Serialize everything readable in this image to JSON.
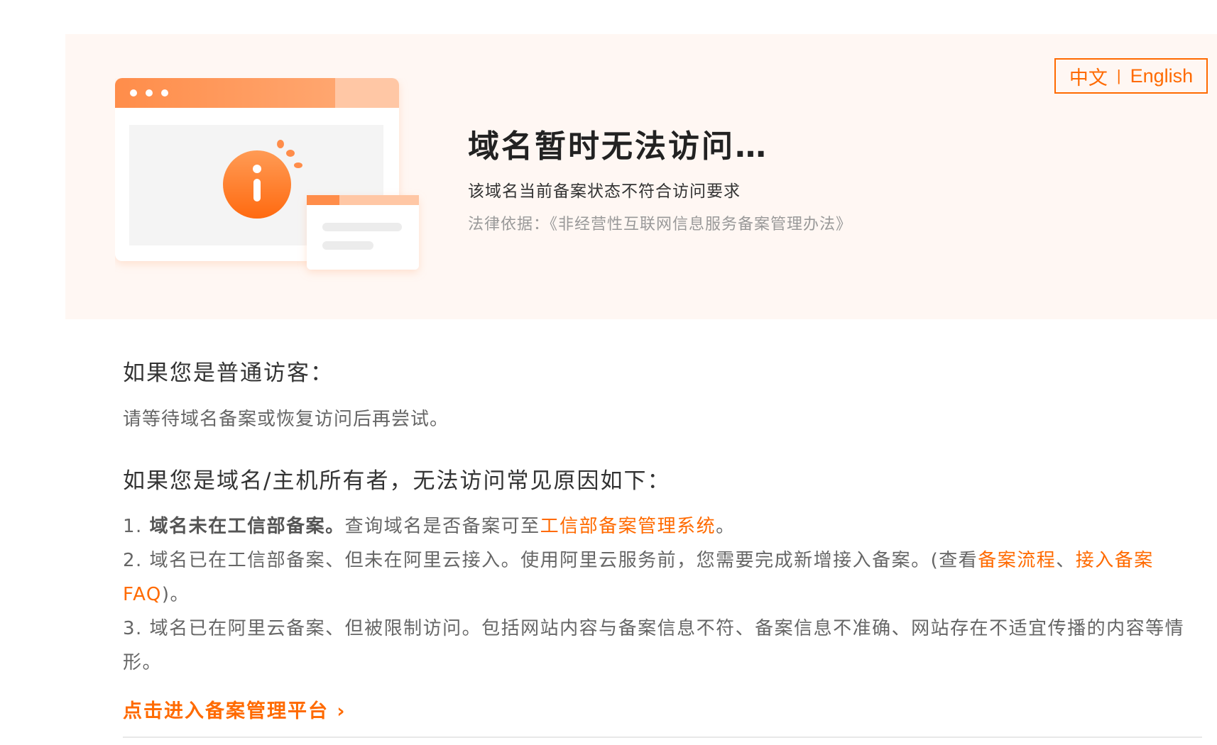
{
  "lang": {
    "zh": "中文",
    "sep": "|",
    "en": "English"
  },
  "hero": {
    "title": "域名暂时无法访问…",
    "subtitle": "该域名当前备案状态不符合访问要求",
    "legal": "法律依据：《非经营性互联网信息服务备案管理办法》"
  },
  "visitor": {
    "heading": "如果您是普通访客：",
    "text": "请等待域名备案或恢复访问后再尝试。"
  },
  "owner": {
    "heading": "如果您是域名/主机所有者，无法访问常见原因如下：",
    "reason1": {
      "num": "1. ",
      "bold": "域名未在工信部备案。",
      "text": "查询域名是否备案可至",
      "link": "工信部备案管理系统",
      "end": "。"
    },
    "reason2": {
      "num": "2. ",
      "text": "域名已在工信部备案、但未在阿里云接入。使用阿里云服务前，您需要完成新增接入备案。(查看",
      "link1": "备案流程",
      "sep": "、",
      "link2": "接入备案FAQ",
      "end": ")。"
    },
    "reason3": {
      "num": "3. ",
      "text": "域名已在阿里云备案、但被限制访问。包括网站内容与备案信息不符、备案信息不准确、网站存在不适宜传播的内容等情形。"
    }
  },
  "cta": {
    "label": "点击进入备案管理平台",
    "arrow": "›"
  },
  "colors": {
    "accent": "#ff6a00",
    "banner_bg": "#fff7f3"
  },
  "icons": [
    "info-icon",
    "browser-window-illustration",
    "chevron-right-icon"
  ]
}
